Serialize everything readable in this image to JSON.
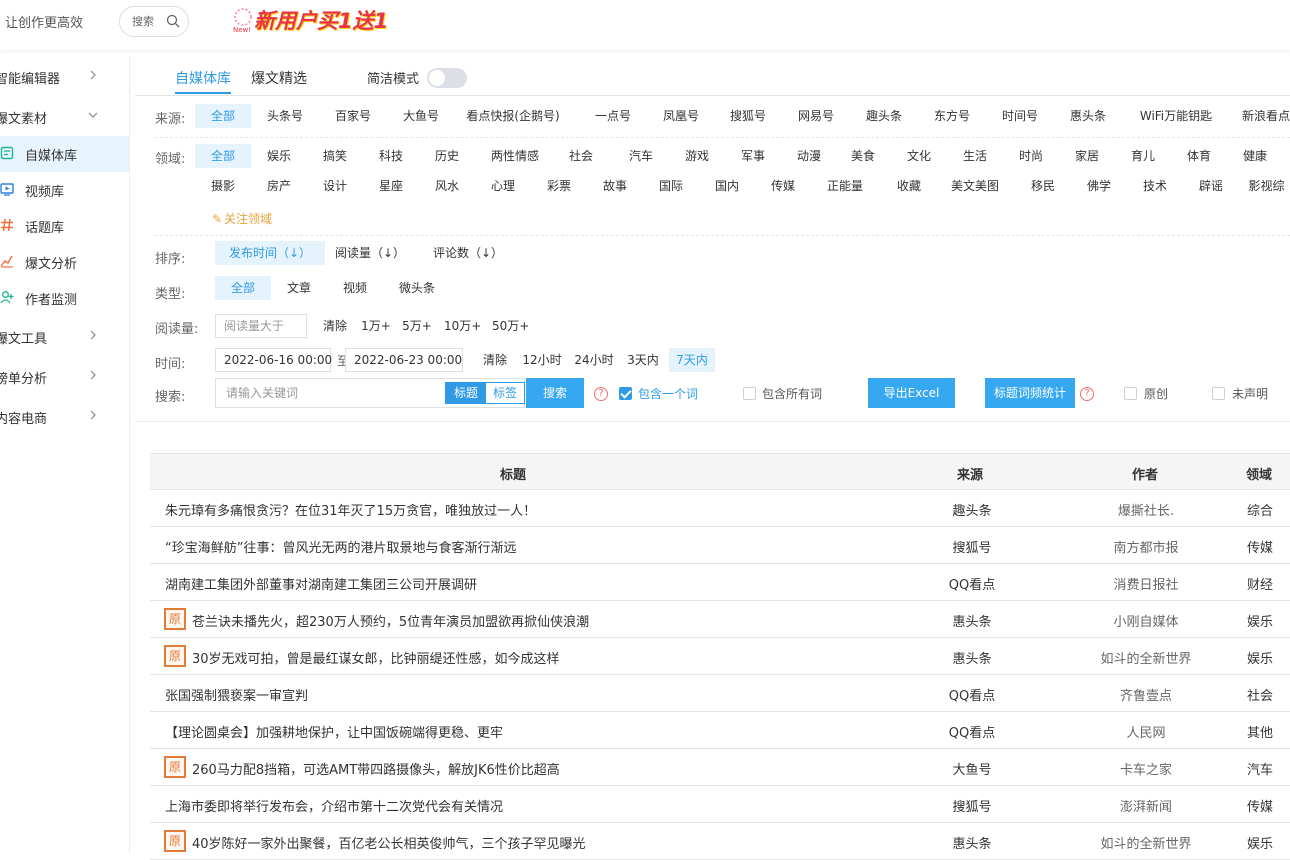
{
  "header": {
    "slogan": "让创作更高效",
    "search_label": "搜索",
    "promo": "新用户买1送1",
    "promo_small": "New!"
  },
  "sidebar": {
    "groups": [
      {
        "label": "智能编辑器"
      },
      {
        "label": "爆文素材"
      },
      {
        "label": "爆文工具"
      },
      {
        "label": "榜单分析"
      },
      {
        "label": "内容电商"
      }
    ],
    "items": [
      {
        "label": "自媒体库",
        "icon": "library-icon"
      },
      {
        "label": "视频库",
        "icon": "video-icon"
      },
      {
        "label": "话题库",
        "icon": "hashtag-icon"
      },
      {
        "label": "爆文分析",
        "icon": "trend-icon"
      },
      {
        "label": "作者监测",
        "icon": "user-add-icon"
      }
    ]
  },
  "tabs": {
    "tab1": "自媒体库",
    "tab2": "爆文精选",
    "simple_mode": "简洁模式"
  },
  "filters": {
    "source_label": "来源:",
    "sources": [
      "全部",
      "头条号",
      "百家号",
      "大鱼号",
      "看点快报(企鹅号)",
      "一点号",
      "凤凰号",
      "搜狐号",
      "网易号",
      "趣头条",
      "东方号",
      "时间号",
      "惠头条",
      "WiFi万能钥匙",
      "新浪看点"
    ],
    "domain_label": "领域:",
    "domains_row1": [
      "全部",
      "娱乐",
      "搞笑",
      "科技",
      "历史",
      "两性情感",
      "社会",
      "汽车",
      "游戏",
      "军事",
      "动漫",
      "美食",
      "文化",
      "生活",
      "时尚",
      "家居",
      "育儿",
      "体育",
      "健康"
    ],
    "domains_row2": [
      "摄影",
      "房产",
      "设计",
      "星座",
      "风水",
      "心理",
      "彩票",
      "故事",
      "国际",
      "国内",
      "传媒",
      "正能量",
      "收藏",
      "美文美图",
      "移民",
      "佛学",
      "技术",
      "辟谣",
      "影视综"
    ],
    "follow_domain": "关注领域",
    "sort_label": "排序:",
    "sorts": [
      "发布时间（↓）",
      "阅读量（↓）",
      "评论数（↓）"
    ],
    "type_label": "类型:",
    "types": [
      "全部",
      "文章",
      "视频",
      "微头条"
    ],
    "reads_label": "阅读量:",
    "reads_placeholder": "阅读量大于",
    "reads_options": [
      "清除",
      "1万+",
      "5万+",
      "10万+",
      "50万+"
    ],
    "time_label": "时间:",
    "time_start": "2022-06-16 00:00",
    "time_to": "至",
    "time_end": "2022-06-23 00:00",
    "time_options": [
      "清除",
      "12小时",
      "24小时",
      "3天内",
      "7天内"
    ],
    "search_label": "搜索:",
    "search_placeholder": "请输入关键词",
    "seg_title": "标题",
    "seg_tag": "标签",
    "search_button": "搜索",
    "include_one": "包含一个词",
    "include_all": "包含所有词",
    "export_button": "导出Excel",
    "word_freq_button": "标题词频统计",
    "original": "原创",
    "undeclared": "未声明",
    "help_glyph": "?"
  },
  "table": {
    "headers": {
      "title": "标题",
      "source": "来源",
      "author": "作者",
      "domain": "领域"
    },
    "original_badge": "原",
    "rows": [
      {
        "title": "朱元璋有多痛恨贪污？在位31年灭了15万贪官，唯独放过一人！",
        "source": "趣头条",
        "author": "爆撕社长.",
        "domain": "综合",
        "original": false
      },
      {
        "title": "“珍宝海鲜舫”往事：曾风光无两的港片取景地与食客渐行渐远",
        "source": "搜狐号",
        "author": "南方都市报",
        "domain": "传媒",
        "original": false
      },
      {
        "title": "湖南建工集团外部董事对湖南建工集团三公司开展调研",
        "source": "QQ看点",
        "author": "消费日报社",
        "domain": "财经",
        "original": false
      },
      {
        "title": "苍兰诀未播先火，超230万人预约，5位青年演员加盟欲再掀仙侠浪潮",
        "source": "惠头条",
        "author": "小刚自媒体",
        "domain": "娱乐",
        "original": true
      },
      {
        "title": "30岁无戏可拍，曾是最红谋女郎，比钟丽缇还性感，如今成这样",
        "source": "惠头条",
        "author": "如斗的全新世界",
        "domain": "娱乐",
        "original": true
      },
      {
        "title": "张国强制猥亵案一审宣判",
        "source": "QQ看点",
        "author": "齐鲁壹点",
        "domain": "社会",
        "original": false
      },
      {
        "title": "【理论圆桌会】加强耕地保护，让中国饭碗端得更稳、更牢",
        "source": "QQ看点",
        "author": "人民网",
        "domain": "其他",
        "original": false
      },
      {
        "title": "260马力配8挡箱，可选AMT带四路摄像头，解放JK6性价比超高",
        "source": "大鱼号",
        "author": "卡车之家",
        "domain": "汽车",
        "original": true
      },
      {
        "title": "上海市委即将举行发布会，介绍市第十二次党代会有关情况",
        "source": "搜狐号",
        "author": "澎湃新闻",
        "domain": "传媒",
        "original": false
      },
      {
        "title": "40岁陈好一家外出聚餐，百亿老公长相英俊帅气，三个孩子罕见曝光",
        "source": "惠头条",
        "author": "如斗的全新世界",
        "domain": "娱乐",
        "original": true
      }
    ]
  },
  "colors": {
    "accent": "#2f9be6",
    "button": "#36a8f1",
    "badge": "#e27a38"
  }
}
